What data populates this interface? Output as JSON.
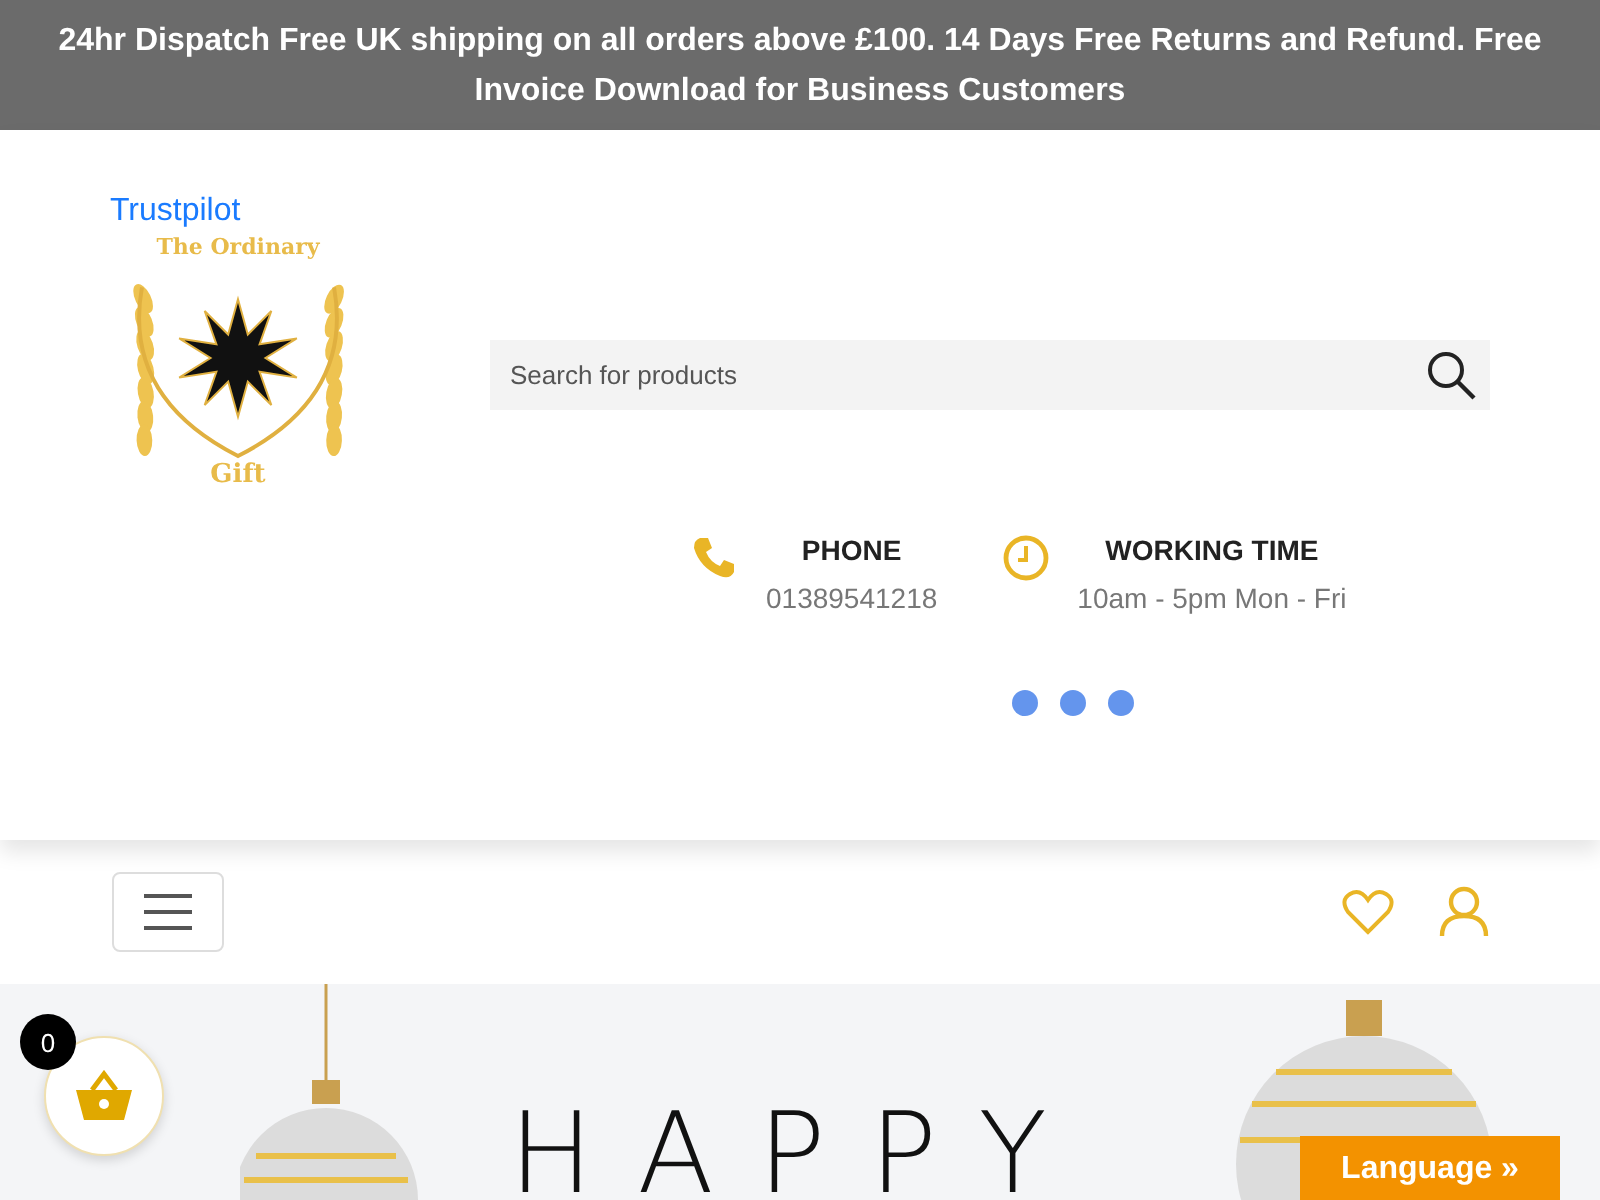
{
  "announcement": "24hr Dispatch Free UK shipping on all orders above £100. 14 Days Free Returns and Refund. Free Invoice Download for Business Customers",
  "trustpilot_link": "Trustpilot",
  "logo": {
    "top_text": "The Ordinary",
    "bottom_text": "Gift"
  },
  "search": {
    "placeholder": "Search for products"
  },
  "contacts": [
    {
      "kind": "phone",
      "title": "PHONE",
      "value": "01389541218"
    },
    {
      "kind": "clock",
      "title": "WORKING TIME",
      "value": "10am - 5pm Mon - Fri"
    }
  ],
  "banner": {
    "headline": "HAPPY"
  },
  "cart": {
    "count": "0"
  },
  "language_button": "Language »"
}
